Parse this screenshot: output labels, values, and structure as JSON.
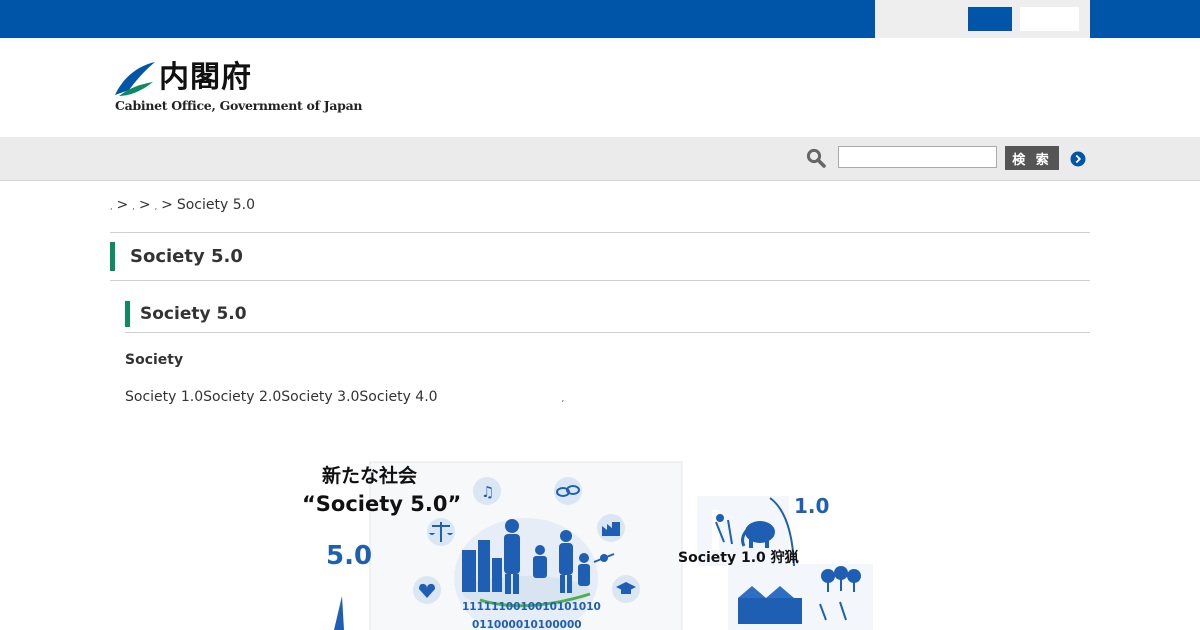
{
  "header": {
    "logo_jp": "内閣府",
    "logo_en": "Cabinet Office, Government of Japan"
  },
  "colors": {
    "brand_blue": "#0055a8",
    "accent_green": "#0e8a5f"
  },
  "search": {
    "value": "",
    "button_label": "検 索",
    "icon": "search-icon",
    "go_icon": "chevron-right-circle-icon"
  },
  "breadcrumb": {
    "items": [
      ",",
      ",",
      ","
    ],
    "separator": ">",
    "current": "Society 5.0"
  },
  "main": {
    "title": "Society 5.0",
    "section_title": "Society 5.0",
    "subheading": "Society",
    "paragraph": "Society 1.0Society 2.0Society 3.0Society 4.0",
    "paragraph_tail": ","
  },
  "illustration": {
    "heading_line1": "新たな社会",
    "heading_line2": "“Society 5.0”",
    "label_5": "5.0",
    "label_1": "1.0",
    "caption_1": "Society 1.0 狩猟",
    "binary_line1": "1111110010010101010",
    "binary_line2": "011000010100000"
  }
}
